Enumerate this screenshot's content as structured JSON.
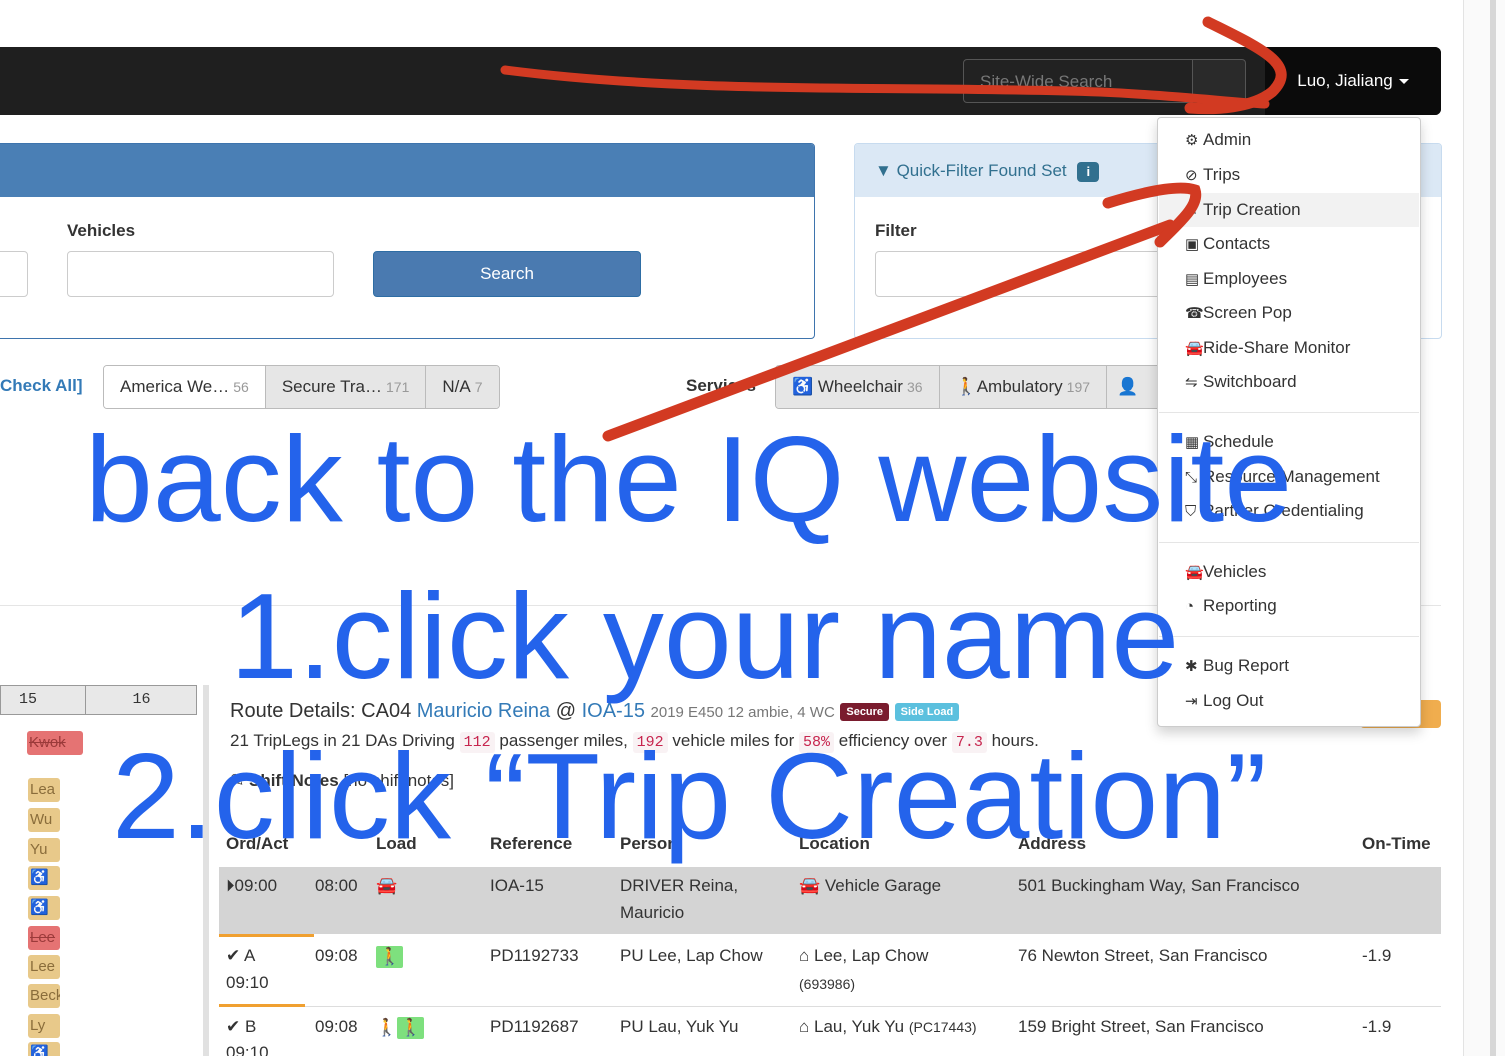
{
  "navbar": {
    "search_placeholder": "Site-Wide Search",
    "user_name": "Luo, Jialiang"
  },
  "search_panel": {
    "vehicles_label": "Vehicles",
    "search_button": "Search"
  },
  "quick_filter": {
    "title": "Quick-Filter Found Set",
    "info_icon": "i",
    "filter_label": "Filter"
  },
  "filters": {
    "check_all": "Check All]",
    "companies": [
      {
        "label": "America We…",
        "count": "56"
      },
      {
        "label": "Secure Tra…",
        "count": "171"
      },
      {
        "label": "N/A",
        "count": "7"
      }
    ],
    "services_label": "Services",
    "services": [
      {
        "icon": "wheelchair-icon",
        "label": "Wheelchair",
        "count": "36"
      },
      {
        "icon": "person-icon",
        "label": "Ambulatory",
        "count": "197"
      }
    ]
  },
  "user_menu": {
    "items": [
      {
        "icon": "gear-icon",
        "label": "Admin"
      },
      {
        "icon": "compass-icon",
        "label": "Trips"
      },
      {
        "icon": "edit-icon",
        "label": "Trip Creation"
      },
      {
        "icon": "briefcase-icon",
        "label": "Contacts"
      },
      {
        "icon": "badge-icon",
        "label": "Employees"
      },
      {
        "icon": "phone-icon",
        "label": "Screen Pop"
      },
      {
        "icon": "car-icon",
        "label": "Ride-Share Monitor"
      },
      {
        "icon": "switch-icon",
        "label": "Switchboard"
      },
      {
        "icon": "calendar-icon",
        "label": "Schedule"
      },
      {
        "icon": "expand-icon",
        "label": "Resource Management"
      },
      {
        "icon": "shield-icon",
        "label": "Partner Credentialing"
      },
      {
        "icon": "car-icon",
        "label": "Vehicles"
      },
      {
        "icon": "pie-chart-icon",
        "label": "Reporting"
      },
      {
        "icon": "star-icon",
        "label": "Bug Report"
      },
      {
        "icon": "logout-icon",
        "label": "Log Out"
      }
    ]
  },
  "calendar": {
    "cols": [
      "15",
      "16"
    ],
    "chips": [
      {
        "label": "Kwok",
        "style": "red"
      },
      {
        "label": "Lea",
        "style": "tan"
      },
      {
        "label": "Wu",
        "style": "tan"
      },
      {
        "label": "Yu",
        "style": "tan"
      },
      {
        "label": "♿ C",
        "style": "tan"
      },
      {
        "label": "♿ C",
        "style": "tan"
      },
      {
        "label": "Lee",
        "style": "red"
      },
      {
        "label": "Lee",
        "style": "tan"
      },
      {
        "label": "Beck",
        "style": "tan"
      },
      {
        "label": "Ly",
        "style": "tan"
      },
      {
        "label": "♿ W",
        "style": "tan"
      }
    ]
  },
  "route": {
    "prefix": "Route Details: CA04",
    "driver": "Mauricio Reina",
    "at": "@",
    "vehicle": "IOA-15",
    "vehicle_desc": "2019 E450 12 ambie, 4 WC",
    "badge_secure": "Secure",
    "badge_side": "Side Load",
    "stats": {
      "a": "21 TripLegs in 21 DAs Driving",
      "passenger_miles": "112",
      "b": "passenger miles,",
      "vehicle_miles": "192",
      "c": "vehicle miles for",
      "efficiency": "58%",
      "d": "efficiency over",
      "hours": "7.3",
      "e": "hours."
    },
    "shift_notes_label": "Shift Notes",
    "shift_notes_value": "[no shift notes]"
  },
  "table": {
    "headers": [
      "Ord/Act",
      "Load",
      "Reference",
      "Person",
      "Location",
      "Address",
      "On-Time"
    ],
    "rows": [
      {
        "ord": "09:00",
        "act": "",
        "time": "08:00",
        "ref": "IOA-15",
        "person1": "DRIVER Reina,",
        "person2": "Mauricio",
        "location": "Vehicle Garage",
        "loc_id": "",
        "address": "501 Buckingham Way, San Francisco",
        "ontime": ""
      },
      {
        "ord": "A",
        "act": "09:10",
        "time": "09:08",
        "ref": "PD1192733",
        "person1": "PU Lee, Lap Chow",
        "person2": "",
        "location": "Lee, Lap Chow",
        "loc_id": "(693986)",
        "address": "76 Newton Street, San Francisco",
        "ontime": "-1.9"
      },
      {
        "ord": "B",
        "act": "09:10",
        "time": "09:08",
        "ref": "PD1192687",
        "person1": "PU Lau, Yuk Yu",
        "person2": "",
        "location": "Lau, Yuk Yu",
        "loc_id": "(PC17443)",
        "address": "159 Bright Street, San Francisco",
        "ontime": "-1.9"
      }
    ]
  },
  "annotation": {
    "line1": "back to the IQ website",
    "line2": "1.click your name",
    "line3": "2.click “Trip Creation”",
    "color": "#2463eb",
    "stroke_color": "#d23a22"
  }
}
